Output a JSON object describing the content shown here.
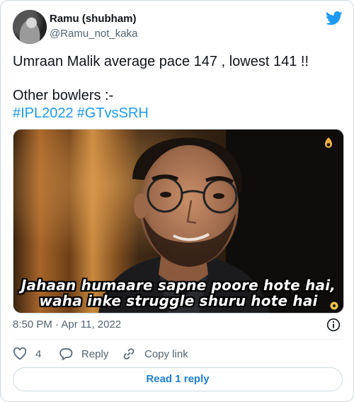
{
  "tweet": {
    "author_name": "Ramu (shubham)",
    "author_handle": "@Ramu_not_kaka",
    "text_line1": "Umraan Malik average pace 147 , lowest 141 !!",
    "text_line2": "Other bowlers :-",
    "hashtags": [
      "#IPL2022",
      "#GTvsSRH"
    ],
    "media_caption_line1": "Jahaan humaare sapne poore hote hai,",
    "media_caption_line2": "waha inke struggle shuru hote hai",
    "timestamp": "8:50 PM · Apr 11, 2022",
    "actions": {
      "like_count": "4",
      "reply_label": "Reply",
      "copy_link_label": "Copy link"
    },
    "read_replies_label": "Read 1 reply"
  },
  "icons": {
    "brand": "twitter-bird-icon",
    "info": "info-icon",
    "like": "heart-icon",
    "reply": "reply-bubble-icon",
    "copy": "link-icon"
  },
  "colors": {
    "brand_blue": "#1d9bf0",
    "text_primary": "#0f1419",
    "text_secondary": "#536471",
    "border": "#cfd9de"
  }
}
